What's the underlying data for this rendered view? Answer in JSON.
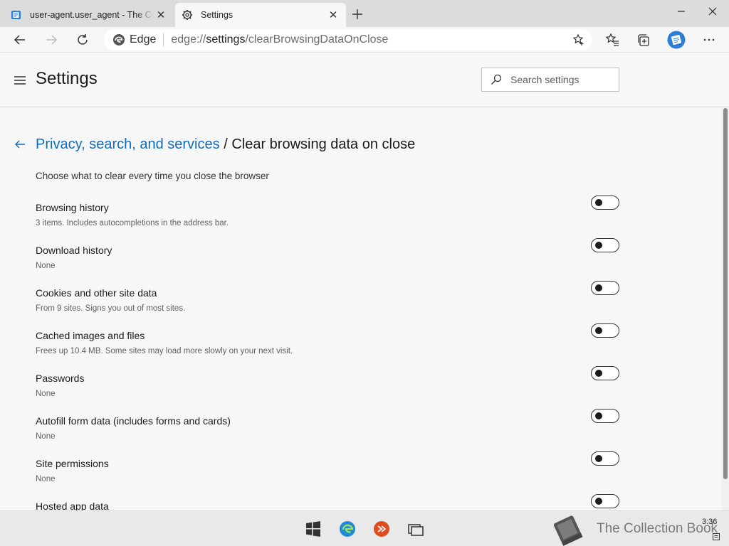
{
  "tabs": [
    {
      "title": "user-agent.user_agent - The Collection Book",
      "active": false,
      "favicon": "collection-book-icon"
    },
    {
      "title": "Settings",
      "active": true,
      "favicon": "gear-icon"
    }
  ],
  "toolbar": {
    "brand": "Edge",
    "url_scheme": "edge://",
    "url_host": "settings",
    "url_path": "/clearBrowsingDataOnClose"
  },
  "header": {
    "title": "Settings",
    "search_placeholder": "Search settings"
  },
  "page": {
    "breadcrumb": "Privacy, search, and services",
    "separator": "/",
    "title": "Clear browsing data on close",
    "intro": "Choose what to clear every time you close the browser"
  },
  "options": [
    {
      "label": "Browsing history",
      "desc": "3 items. Includes autocompletions in the address bar.",
      "enabled": false
    },
    {
      "label": "Download history",
      "desc": "None",
      "enabled": false
    },
    {
      "label": "Cookies and other site data",
      "desc": "From 9 sites. Signs you out of most sites.",
      "enabled": false
    },
    {
      "label": "Cached images and files",
      "desc": "Frees up 10.4 MB. Some sites may load more slowly on your next visit.",
      "enabled": false
    },
    {
      "label": "Passwords",
      "desc": "None",
      "enabled": false
    },
    {
      "label": "Autofill form data (includes forms and cards)",
      "desc": "None",
      "enabled": false
    },
    {
      "label": "Site permissions",
      "desc": "None",
      "enabled": false
    },
    {
      "label": "Hosted app data",
      "desc": "",
      "enabled": false
    }
  ],
  "taskbar": {
    "watermark": "The Collection Book",
    "clock": "3:36"
  },
  "colors": {
    "link": "#0f6cbd",
    "accent": "#2b7fd6"
  }
}
